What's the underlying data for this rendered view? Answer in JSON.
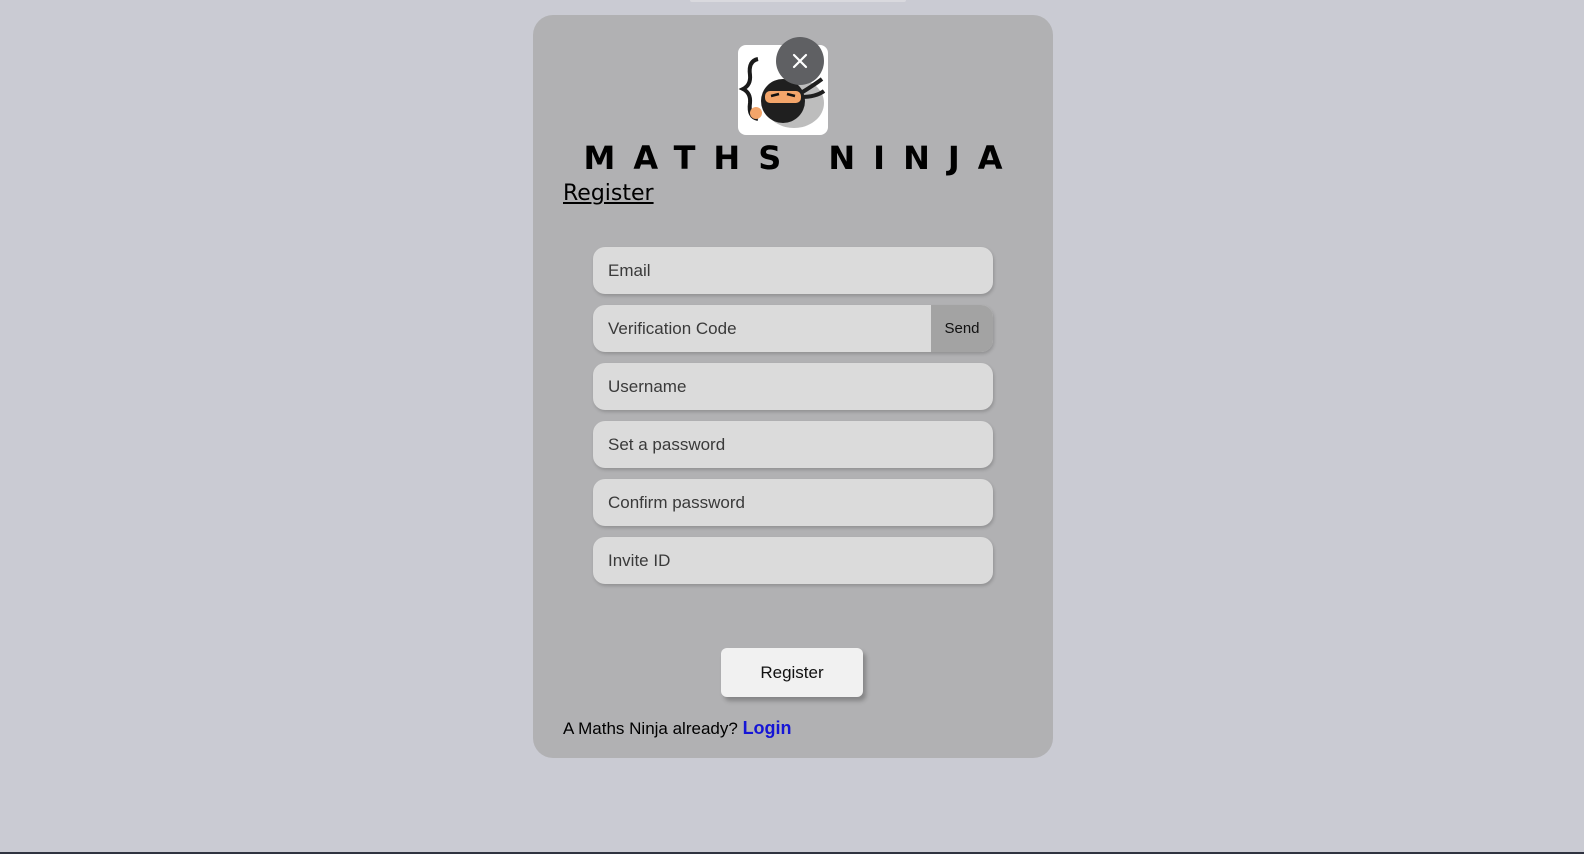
{
  "brand": {
    "title": "MATHS NINJA",
    "logo_icon": "ninja-logo-icon"
  },
  "modal": {
    "close_icon": "close-icon",
    "heading": "Register"
  },
  "form": {
    "email_placeholder": "Email",
    "verification_placeholder": "Verification Code",
    "send_label": "Send",
    "username_placeholder": "Username",
    "password_placeholder": "Set a password",
    "confirm_placeholder": "Confirm password",
    "invite_placeholder": "Invite ID",
    "submit_label": "Register"
  },
  "footer": {
    "prompt": "A Maths Ninja already?",
    "login_label": "Login"
  },
  "colors": {
    "page_background": "#cacbd3",
    "modal_background": "#b1b1b3",
    "input_background": "#dbdbdb",
    "link": "#1515d6"
  }
}
